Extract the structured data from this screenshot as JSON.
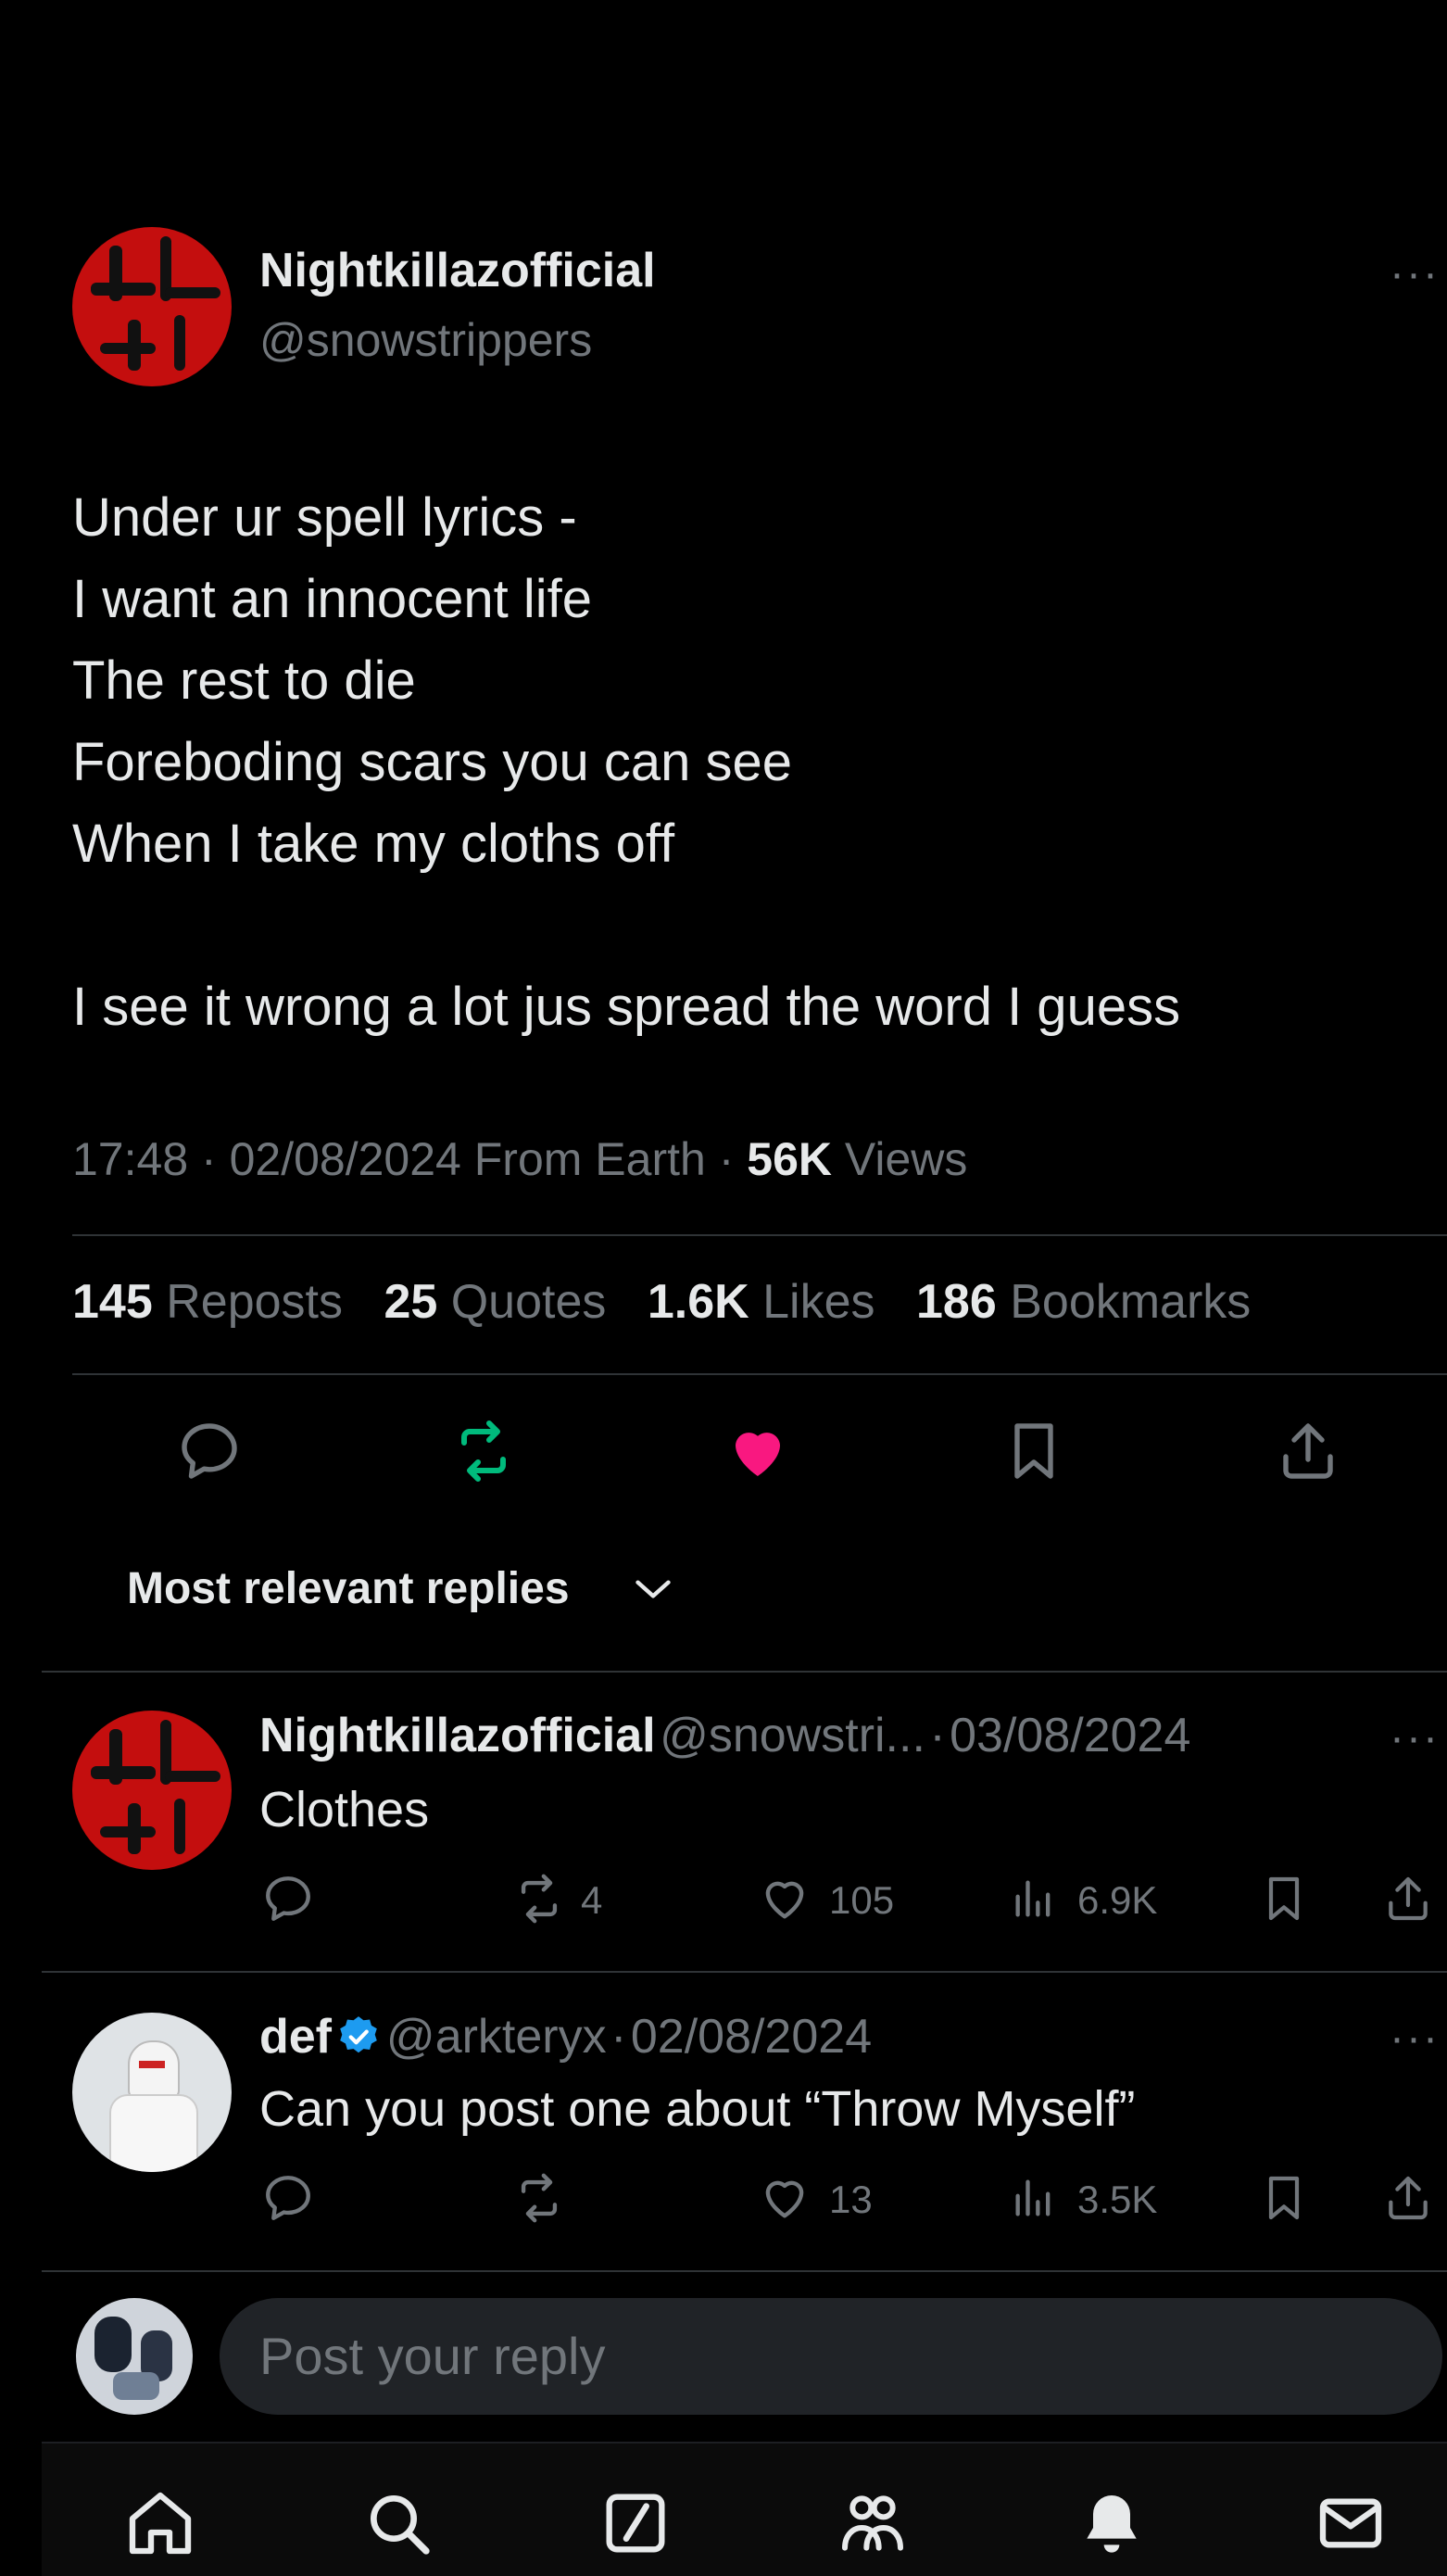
{
  "post": {
    "display_name": "Nightkillazofficial",
    "handle": "@snowstrippers",
    "more_label": "···",
    "body": "Under ur spell lyrics -\nI want an innocent life\nThe rest to die\nForeboding scars you can see\nWhen I take my cloths off\n\nI see it wrong a lot jus spread the word I guess",
    "time": "17:48",
    "date": "02/08/2024",
    "location": "From Earth",
    "views_count": "56K",
    "views_label": "Views",
    "sep": "·"
  },
  "stats": {
    "reposts_count": "145",
    "reposts_label": "Reposts",
    "quotes_count": "25",
    "quotes_label": "Quotes",
    "likes_count": "1.6K",
    "likes_label": "Likes",
    "bookmarks_count": "186",
    "bookmarks_label": "Bookmarks"
  },
  "actions": {
    "icons": [
      "reply-icon",
      "repost-icon",
      "like-icon",
      "bookmark-icon",
      "share-icon"
    ],
    "repost_color": "#00ba7c",
    "like_color": "#f91880"
  },
  "replies_sort": {
    "label": "Most relevant replies"
  },
  "replies": [
    {
      "display_name": "Nightkillazofficial",
      "handle": "@snowstri...",
      "date": "03/08/2024",
      "text": "Clothes",
      "reposts": "4",
      "likes": "105",
      "views": "6.9K",
      "verified": false
    },
    {
      "display_name": "def",
      "handle": "@arkteryx",
      "date": "02/08/2024",
      "text": "Can you post one about “Throw Myself”",
      "reposts": "",
      "likes": "13",
      "views": "3.5K",
      "verified": true
    }
  ],
  "composer": {
    "placeholder": "Post your reply"
  },
  "tabbar": {
    "icons": [
      "home-icon",
      "search-icon",
      "grok-icon",
      "communities-icon",
      "notifications-icon",
      "messages-icon"
    ]
  },
  "colors": {
    "background": "#000000",
    "text": "#e7e9ea",
    "muted": "#71767b",
    "verified": "#1d9bf0"
  }
}
